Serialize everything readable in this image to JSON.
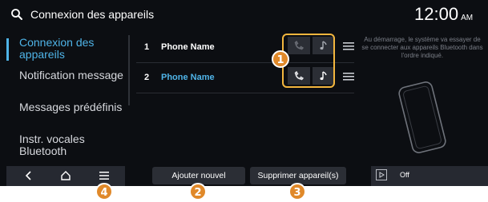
{
  "topbar": {
    "title": "Connexion des appareils",
    "clock": "12:00",
    "ampm": "AM"
  },
  "sidebar": {
    "items": [
      {
        "label": "Connexion des appareils",
        "active": true
      },
      {
        "label": "Notification message",
        "active": false
      },
      {
        "label": "Messages prédéfinis",
        "active": false
      },
      {
        "label": "Instr. vocales Bluetooth",
        "active": false
      }
    ]
  },
  "devices": [
    {
      "number": "1",
      "name": "Phone Name",
      "connected": false
    },
    {
      "number": "2",
      "name": "Phone Name",
      "connected": true
    }
  ],
  "help_text": "Au démarrage, le système va essayer de se connecter aux appareils Bluetooth dans l'ordre indiqué.",
  "buttons": {
    "add": "Ajouter nouvel",
    "delete": "Supprimer appareil(s)"
  },
  "media": {
    "status": "Off"
  },
  "callouts": {
    "c1": "1",
    "c2": "2",
    "c3": "3",
    "c4": "4"
  },
  "colors": {
    "accent": "#4fb4e8",
    "callout": "#e0892a",
    "background": "#0c0e12"
  },
  "icons": {
    "topbar": "search-icon",
    "device_actions": [
      "phone-call-icon",
      "music-note-icon",
      "reorder-menu-icon"
    ],
    "navbar": [
      "back-icon",
      "home-icon",
      "menu-icon"
    ],
    "media": "play-icon",
    "illustration": "smartphone-icon"
  }
}
